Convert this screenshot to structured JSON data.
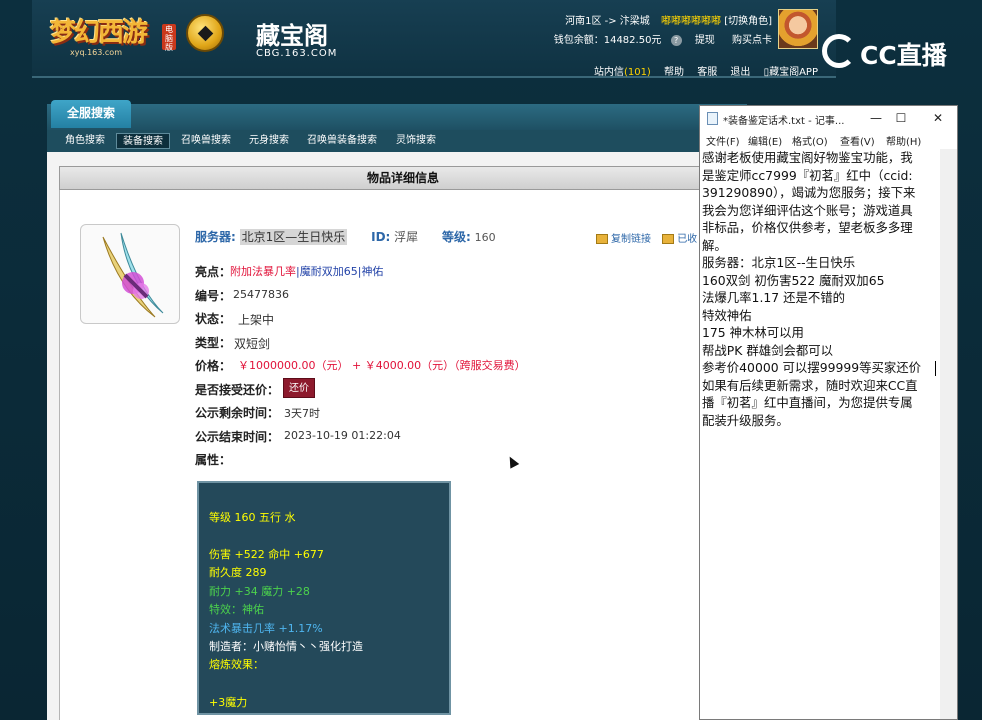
{
  "header": {
    "logo1": {
      "name": "梦幻西游",
      "tag": "电脑版",
      "url": "xyq.163.com"
    },
    "logo2": {
      "name": "藏宝阁",
      "url": "CBG.163.COM"
    },
    "user": {
      "location": "河南1区 -> 汴梁城",
      "nickname": "嘟嘟嘟嘟嘟嘟",
      "switch_role": "[切换角色]",
      "wallet_label": "钱包余额：",
      "wallet_amount": "14482.50元",
      "withdraw": "提现",
      "buy_card": "购买点卡"
    },
    "nav": {
      "messages": "站内信",
      "messages_count": "(101)",
      "help": "帮助",
      "service": "客服",
      "logout": "退出",
      "app": "藏宝阁APP"
    }
  },
  "overlay": {
    "logo_text": "CC直播"
  },
  "tabs": {
    "main": "全服搜索",
    "sub": [
      "角色搜索",
      "装备搜索",
      "召唤兽搜索",
      "元身搜索",
      "召唤兽装备搜索",
      "灵饰搜索"
    ]
  },
  "detail": {
    "header": "物品详细信息",
    "server_label": "服务器:",
    "server_value": "北京1区—生日快乐",
    "id_label": "ID:",
    "id_value": "浮犀",
    "level_label": "等级:",
    "level_value": "160",
    "copy_link": "复制链接",
    "copy_link_extra": "已收",
    "highlights_label": "亮点：",
    "highlights": [
      "附加法暴几率",
      "|",
      "魔耐双加65",
      "|",
      "神佑"
    ],
    "code_label": "编号：",
    "code_value": "25477836",
    "status_label": "状态：",
    "status_value": "上架中",
    "type_label": "类型：",
    "type_value": "双短剑",
    "price_label": "价格：",
    "price_value": "￥1000000.00（元） + ￥4000.00（元）（跨服交易费）",
    "bargain_label": "是否接受还价：",
    "bargain_button": "还价",
    "remaining_label": "公示剩余时间：",
    "remaining_value": "3天7时",
    "end_label": "公示结束时间：",
    "end_value": "2023-10-19 01:22:04",
    "attr_label": "属性：",
    "tooltip": [
      "等级 160 五行 水",
      "伤害 +522 命中 +677",
      "耐久度 289",
      "耐力 +34 魔力 +28",
      "特效：神佑",
      "法术暴击几率 +1.17%",
      "制造者：小赌怡情丶丶强化打造",
      "熔炼效果：",
      "+3魔力"
    ]
  },
  "notepad": {
    "title": "*装备鉴定话术.txt - 记事...",
    "minimize": "—",
    "maximize": "☐",
    "close": "✕",
    "menu": [
      "文件(F)",
      "编辑(E)",
      "格式(O)",
      "查看(V)",
      "帮助(H)"
    ],
    "lines": [
      "感谢老板使用藏宝阁好物鉴宝功能，我",
      "是鉴定师cc7999『初茗』红中（ccid:",
      "391290890），竭诚为您服务；接下来",
      "我会为您详细评估这个账号；游戏道具",
      "非标品，价格仅供参考，望老板多多理",
      "解。",
      "服务器：北京1区--生日快乐",
      "160双剑  初伤害522   魔耐双加65",
      "法爆几率1.17  还是不错的",
      "特效神佑",
      "175 神木林可以用",
      "帮战PK  群雄剑会都可以",
      "参考价40000  可以摆99999等买家还价",
      "如果有后续更新需求，随时欢迎来CC直",
      "播『初茗』红中直播间，为您提供专属",
      "配装升级服务。"
    ]
  },
  "colors": {
    "highlight_red": "#e1133a",
    "link_blue": "#2d67a8",
    "tooltip_bg": "#24495a",
    "tooltip_yellow": "#ffff00",
    "tooltip_green": "#4cd24c",
    "tooltip_cyan": "#4fb6f0"
  }
}
